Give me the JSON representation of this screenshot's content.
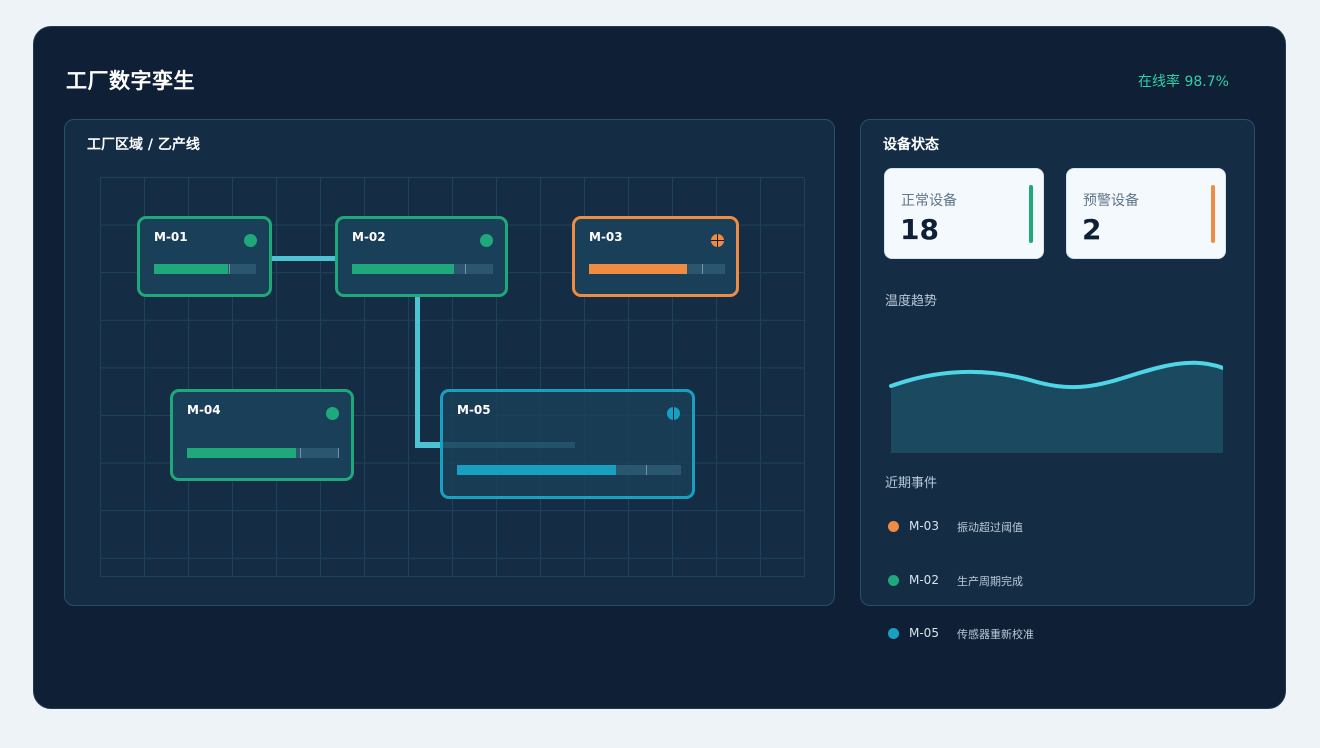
{
  "app": {
    "title": "工厂数字孪生",
    "online_status": "在线率 98.7%"
  },
  "floor": {
    "title": "工厂区域 / 乙产线",
    "machines": [
      {
        "id": "M-01",
        "status": "normal",
        "progress": 0.73,
        "color": "#1fa97b"
      },
      {
        "id": "M-02",
        "status": "normal",
        "progress": 0.72,
        "color": "#1fa97b"
      },
      {
        "id": "M-03",
        "status": "warning",
        "progress": 0.72,
        "color": "#ef8c41"
      },
      {
        "id": "M-04",
        "status": "normal",
        "progress": 0.72,
        "color": "#1fa97b"
      },
      {
        "id": "M-05",
        "status": "active",
        "progress": 0.71,
        "color": "#17a0bf"
      }
    ]
  },
  "status_panel": {
    "title": "设备状态",
    "normal": {
      "label": "正常设备",
      "value": "18",
      "accent": "#1fa97b"
    },
    "warning": {
      "label": "预警设备",
      "value": "2",
      "accent": "#ef8c41"
    },
    "trend_label": "温度趋势",
    "events_label": "近期事件",
    "events": [
      {
        "id": "M-03",
        "text": "振动超过阈值",
        "color": "#ef8c41"
      },
      {
        "id": "M-02",
        "text": "生产周期完成",
        "color": "#1fa97b"
      },
      {
        "id": "M-05",
        "text": "传感器重新校准",
        "color": "#17a0bf"
      }
    ]
  },
  "colors": {
    "background": "#0f2036",
    "accent_normal": "#1fa97b",
    "accent_warning": "#ef8c41",
    "accent_active": "#17a0bf",
    "trend_line": "#4fd6e6"
  }
}
